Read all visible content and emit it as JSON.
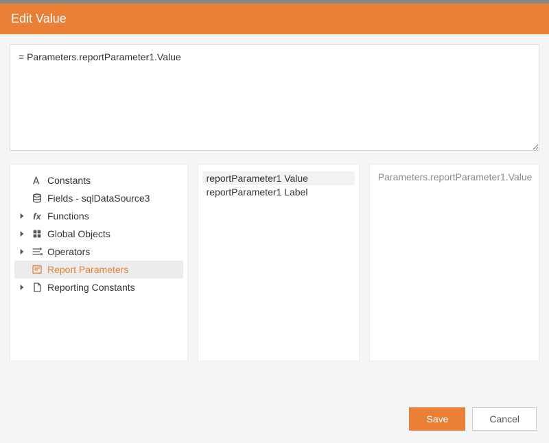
{
  "header": {
    "title": "Edit Value"
  },
  "expression": {
    "value": "= Parameters.reportParameter1.Value"
  },
  "tree": {
    "items": [
      {
        "icon": "font",
        "label": "Constants",
        "expandable": false
      },
      {
        "icon": "database",
        "label": "Fields - sqlDataSource3",
        "expandable": false
      },
      {
        "icon": "fx",
        "label": "Functions",
        "expandable": true
      },
      {
        "icon": "globe",
        "label": "Global Objects",
        "expandable": true
      },
      {
        "icon": "operators",
        "label": "Operators",
        "expandable": true
      },
      {
        "icon": "param",
        "label": "Report Parameters",
        "expandable": false,
        "selected": true
      },
      {
        "icon": "report",
        "label": "Reporting Constants",
        "expandable": true
      }
    ]
  },
  "list": {
    "items": [
      {
        "label": "reportParameter1 Value",
        "selected": true
      },
      {
        "label": "reportParameter1 Label",
        "selected": false
      }
    ]
  },
  "detail": {
    "text": "Parameters.reportParameter1.Value"
  },
  "buttons": {
    "save": "Save",
    "cancel": "Cancel"
  }
}
